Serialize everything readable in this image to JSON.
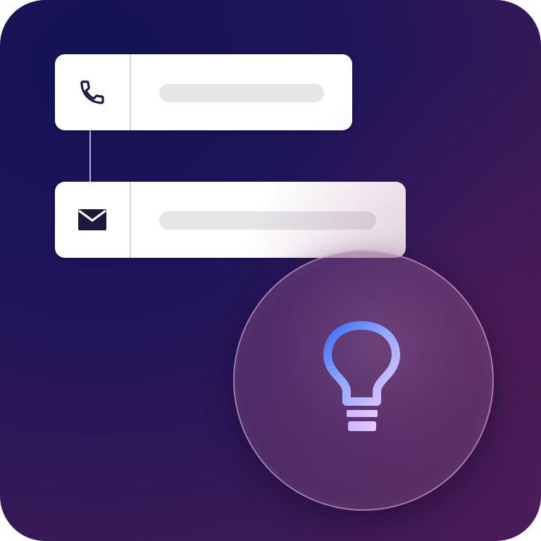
{
  "card": {
    "background_colors": [
      "#141255",
      "#2a1758",
      "#4a1c57"
    ]
  },
  "contact_fields": [
    {
      "icon": "phone-icon",
      "placeholder_color": "#e6e6e9"
    },
    {
      "icon": "envelope-icon",
      "placeholder_color": "#e6e6e9"
    }
  ],
  "idea_badge": {
    "icon": "lightbulb-icon",
    "gradient_colors": [
      "#3d6df5",
      "#b7a8ff",
      "#e6c8ff"
    ]
  }
}
